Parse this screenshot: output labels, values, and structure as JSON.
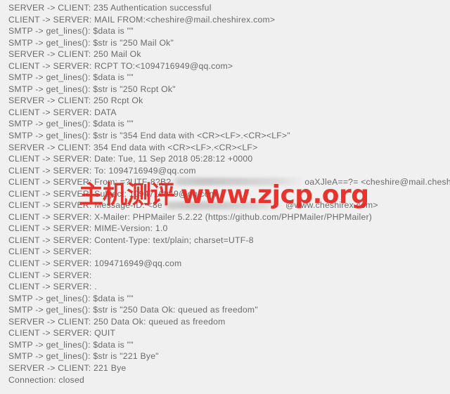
{
  "console": {
    "background_color": "#f0f0f0",
    "text_color": "#6a6a6a",
    "lines": [
      {
        "text": "SERVER -> CLIENT: 235 Authentication successful"
      },
      {
        "text": "CLIENT -> SERVER: MAIL FROM:<cheshire@mail.cheshirex.com>"
      },
      {
        "text": "SMTP -> get_lines(): $data is \"\""
      },
      {
        "text": "SMTP -> get_lines(): $str is \"250 Mail Ok\""
      },
      {
        "text": "SERVER -> CLIENT: 250 Mail Ok"
      },
      {
        "text": "CLIENT -> SERVER: RCPT TO:<1094716949@qq.com>"
      },
      {
        "text": "SMTP -> get_lines(): $data is \"\""
      },
      {
        "text": "SMTP -> get_lines(): $str is \"250 Rcpt Ok\""
      },
      {
        "text": "SERVER -> CLIENT: 250 Rcpt Ok"
      },
      {
        "text": "CLIENT -> SERVER: DATA"
      },
      {
        "text": "SMTP -> get_lines(): $data is \"\""
      },
      {
        "text": "SMTP -> get_lines(): $str is \"354 End data with <CR><LF>.<CR><LF>\""
      },
      {
        "text": "SERVER -> CLIENT: 354 End data with <CR><LF>.<CR><LF>"
      },
      {
        "text": "CLIENT -> SERVER: Date: Tue, 11 Sep 2018 05:28:12 +0000"
      },
      {
        "text": "CLIENT -> SERVER: To: 1094716949@qq.com"
      },
      {
        "prefix": "CLIENT -> SERVER: From: =?UTF-8?B?",
        "redacted_width": 190,
        "suffix": "oaXJleA==?= <cheshire@mail.cheshirex.com>"
      },
      {
        "text": "CLIENT -> SERVER: Subject: 1094716949@qq.com"
      },
      {
        "prefix": "CLIENT -> SERVER: Message-ID: <8e",
        "redacted_width": 175,
        "suffix": "@www.cheshirex.com>"
      },
      {
        "text": "CLIENT -> SERVER: X-Mailer: PHPMailer 5.2.22 (https://github.com/PHPMailer/PHPMailer)"
      },
      {
        "text": "CLIENT -> SERVER: MIME-Version: 1.0"
      },
      {
        "text": "CLIENT -> SERVER: Content-Type: text/plain; charset=UTF-8"
      },
      {
        "text": "CLIENT -> SERVER:"
      },
      {
        "text": "CLIENT -> SERVER: 1094716949@qq.com"
      },
      {
        "text": "CLIENT -> SERVER:"
      },
      {
        "text": "CLIENT -> SERVER: ."
      },
      {
        "text": "SMTP -> get_lines(): $data is \"\""
      },
      {
        "text": "SMTP -> get_lines(): $str is \"250 Data Ok: queued as freedom\""
      },
      {
        "text": "SERVER -> CLIENT: 250 Data Ok: queued as freedom"
      },
      {
        "text": "CLIENT -> SERVER: QUIT"
      },
      {
        "text": "SMTP -> get_lines(): $data is \"\""
      },
      {
        "text": "SMTP -> get_lines(): $str is \"221 Bye\""
      },
      {
        "text": "SERVER -> CLIENT: 221 Bye"
      },
      {
        "text": "Connection: closed"
      }
    ]
  },
  "watermark": {
    "brand_cn": "主机测评",
    "url": "www.zjcp.org",
    "color": "#e8251f"
  }
}
